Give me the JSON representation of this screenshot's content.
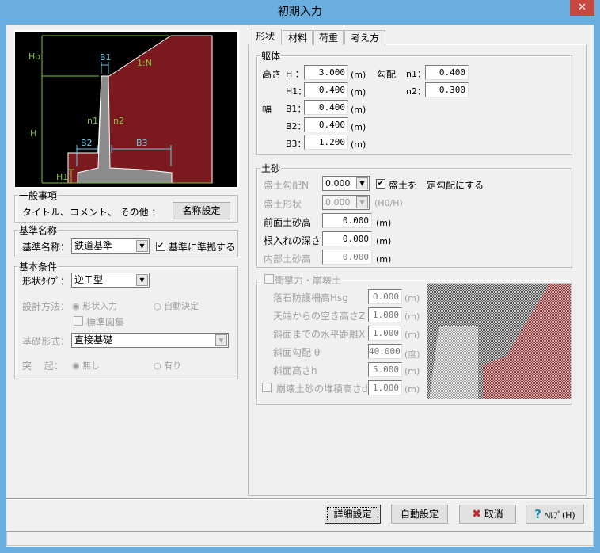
{
  "window": {
    "title": "初期入力",
    "close": "✕"
  },
  "diagram": {
    "labels": {
      "ho": "Ho",
      "h": "H",
      "h1": "H1",
      "b1": "B1",
      "b2": "B2",
      "b3": "B3",
      "n1": "n1",
      "n2": "n2",
      "slope": "1:N"
    },
    "colors": {
      "soil": "#7a1a1e",
      "wall": "#8c8c8c",
      "dim_green": "#7fc63a",
      "dim_cyan": "#6cc7e0"
    }
  },
  "general": {
    "legend": "一般事項",
    "text": "タイトル、コメント、 その他 ：",
    "button": "名称設定"
  },
  "standard": {
    "legend": "基準名称",
    "label": "基準名称：",
    "value": "鉄道基準",
    "check_label": "基準に準拠する",
    "checked": true
  },
  "basic": {
    "legend": "基本条件",
    "shape_label": "形状ﾀｲﾌﾟ：",
    "shape_value": "逆Ｔ型",
    "design_label": "設計方法：",
    "design_opt1": "形状入力",
    "design_opt2": "自動決定",
    "std_fig": "標準図集",
    "found_label": "基礎形式：",
    "found_value": "直接基礎",
    "proj_label": "突　 起：",
    "proj_opt1": "無し",
    "proj_opt2": "有り"
  },
  "tabs": [
    "形状",
    "材料",
    "荷重",
    "考え方"
  ],
  "body": {
    "legend": "躯体",
    "height": "高さ",
    "width": "幅",
    "slope": "勾配",
    "H_label": "H ：",
    "H": "3.000",
    "H1_label": "H1：",
    "H1": "0.400",
    "B1_label": "B1：",
    "B1": "0.400",
    "B2_label": "B2：",
    "B2": "0.400",
    "B3_label": "B3：",
    "B3": "1.200",
    "n1_label": "n1：",
    "n1": "0.400",
    "n2_label": "n2：",
    "n2": "0.300",
    "unit": "(m)"
  },
  "soil": {
    "legend": "土砂",
    "fill_slope_label": "盛土勾配N",
    "fill_slope": "0.000",
    "const_slope": "盛土を一定勾配にする",
    "const_checked": true,
    "fill_shape_label": "盛土形状",
    "fill_shape": "0.000",
    "fill_shape_unit": "(H0/H)",
    "front_label": "前面土砂高",
    "front": "0.000",
    "embed_label": "根入れの深さ",
    "embed": "0.000",
    "inner_label": "内部土砂高",
    "inner": "0.000",
    "unit": "(m)"
  },
  "impact": {
    "legend": "衝撃力・崩壊土",
    "rows": [
      {
        "label": "落石防護柵高Hsg",
        "value": "0.000",
        "unit": "(m)"
      },
      {
        "label": "天端からの空き高さZ",
        "value": "1.000",
        "unit": "(m)"
      },
      {
        "label": "斜面までの水平距離X",
        "value": "1.000",
        "unit": "(m)"
      },
      {
        "label": "斜面勾配 θ",
        "value": "40.000",
        "unit": "(度)"
      },
      {
        "label": "斜面高さh",
        "value": "5.000",
        "unit": "(m)"
      },
      {
        "label": "崩壊土砂の堆積高さd",
        "value": "1.000",
        "unit": "(m)"
      }
    ]
  },
  "buttons": {
    "detail": "詳細設定",
    "auto": "自動設定",
    "cancel": "取消",
    "help": "ﾍﾙﾌﾟ(H)"
  }
}
